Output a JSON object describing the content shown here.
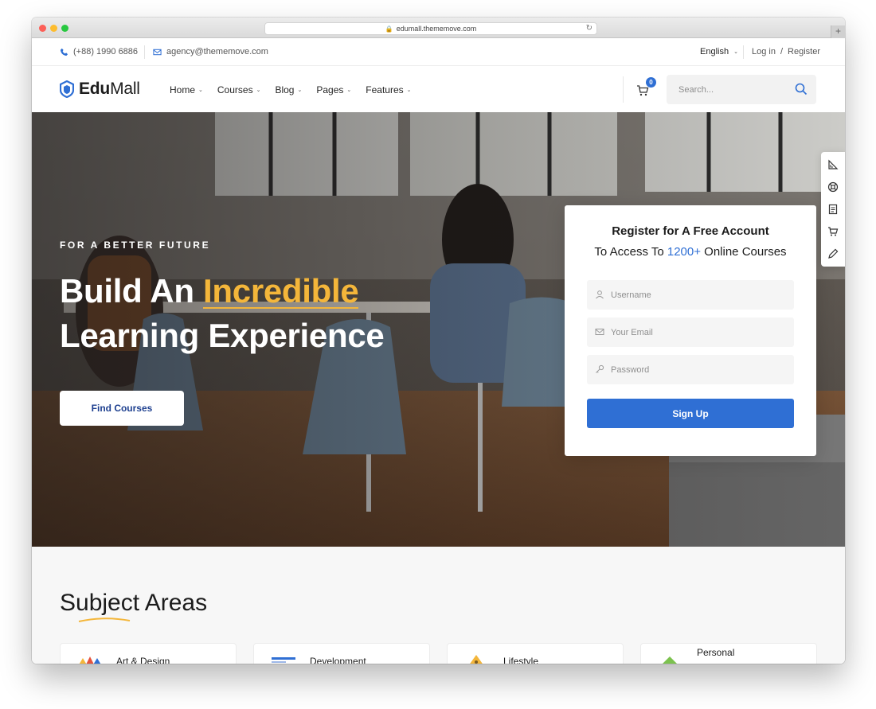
{
  "browser": {
    "url": "edumall.thememove.com"
  },
  "topbar": {
    "phone": "(+88) 1990 6886",
    "email": "agency@thememove.com",
    "language": "English",
    "login": "Log in",
    "slash": "/",
    "register": "Register"
  },
  "header": {
    "logo_bold": "Edu",
    "logo_light": "Mall",
    "nav": [
      "Home",
      "Courses",
      "Blog",
      "Pages",
      "Features"
    ],
    "cart_count": "0",
    "search_placeholder": "Search..."
  },
  "hero": {
    "eyebrow": "FOR A BETTER FUTURE",
    "headline_part1": "Build An ",
    "headline_accent": "Incredible",
    "headline_line2": "Learning Experience",
    "cta": "Find Courses"
  },
  "register": {
    "title": "Register for A Free Account",
    "sub_before": "To Access To ",
    "sub_highlight": "1200+",
    "sub_after": " Online Courses",
    "username_placeholder": "Username",
    "email_placeholder": "Your Email",
    "password_placeholder": "Password",
    "submit": "Sign Up"
  },
  "subjects": {
    "title": "Subject Areas",
    "cards": [
      "Art & Design",
      "Development",
      "Lifestyle",
      "Personal"
    ]
  },
  "colors": {
    "accent": "#2f6fd4",
    "highlight": "#f4b63a",
    "dark": "#1c1c1c"
  }
}
